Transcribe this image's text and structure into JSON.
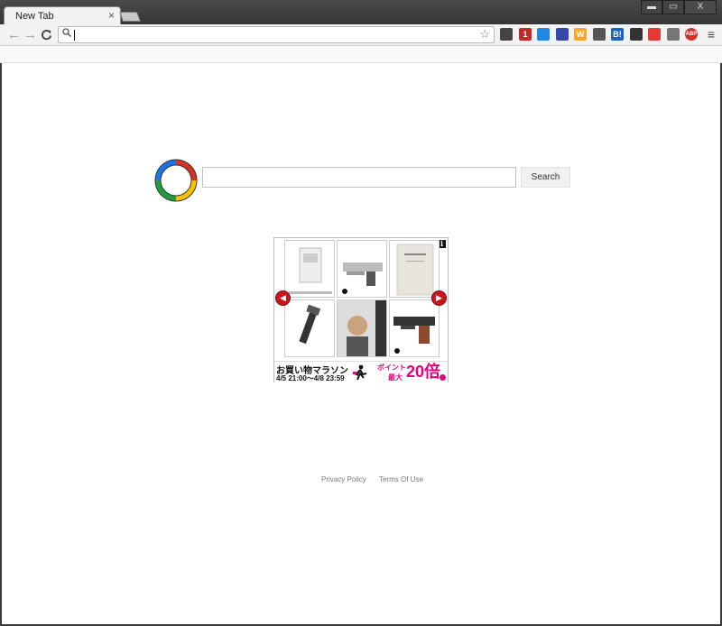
{
  "browser": {
    "tab_title": "New Tab",
    "tab_close": "×",
    "window_controls": {
      "minimize": "▬",
      "restore": "▭",
      "close": "X"
    },
    "nav": {
      "back": "←",
      "forward": "→",
      "reload": "C"
    },
    "address_bar": {
      "value": "",
      "search_icon": "search-icon",
      "star_icon": "star-icon"
    },
    "extensions": [
      {
        "name": "pocket-icon",
        "label": "",
        "color": "#444444"
      },
      {
        "name": "one-icon",
        "label": "1",
        "color": "#c62828"
      },
      {
        "name": "cloud-icon",
        "label": "",
        "color": "#1e88e5"
      },
      {
        "name": "camera-icon",
        "label": "",
        "color": "#3949ab"
      },
      {
        "name": "w-icon",
        "label": "W",
        "color": "#f9a825"
      },
      {
        "name": "qr-icon",
        "label": "",
        "color": "#555555"
      },
      {
        "name": "hatena-icon",
        "label": "B!",
        "color": "#1565c0"
      },
      {
        "name": "hand-icon",
        "label": "",
        "color": "#333333"
      },
      {
        "name": "colorful-icon",
        "label": "",
        "color": "#e53935"
      },
      {
        "name": "keyboard-icon",
        "label": "",
        "color": "#777777"
      },
      {
        "name": "abp-icon",
        "label": "ABP",
        "color": "#d32f2f"
      }
    ],
    "menu_icon": "≡"
  },
  "search": {
    "query": "",
    "button_label": "Search"
  },
  "ad": {
    "info_label": "i",
    "prev_arrow": "◀",
    "next_arrow": "▶",
    "banner": {
      "title": "お買い物マラソン",
      "dates": "4/5 21:00～4/8 23:59",
      "point_label": "ポイント",
      "max_label": "最大",
      "multiplier": "20倍"
    }
  },
  "footer": {
    "privacy": "Privacy Policy",
    "terms": "Terms Of Use"
  }
}
